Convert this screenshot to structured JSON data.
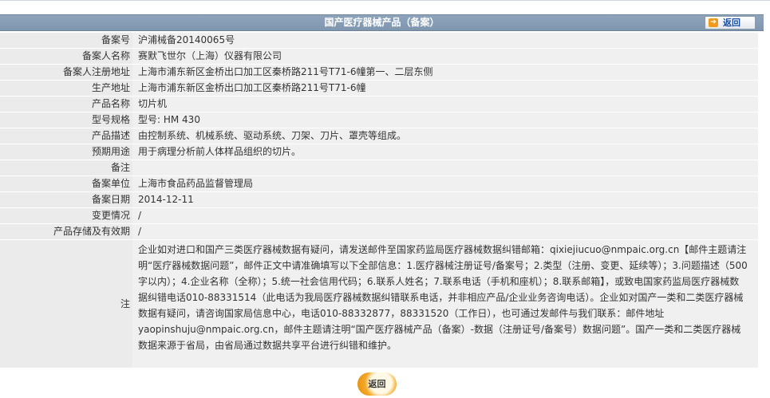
{
  "header": {
    "title": "国产医疗器械产品（备案）",
    "back_label": "返回",
    "back_icon": "arrow-right-icon"
  },
  "rows": [
    {
      "label": "备案号",
      "value": "沪浦械备20140065号"
    },
    {
      "label": "备案人名称",
      "value": "赛默飞世尔（上海）仪器有限公司"
    },
    {
      "label": "备案人注册地址",
      "value": "上海市浦东新区金桥出口加工区秦桥路211号T71-6幢第一、二层东侧"
    },
    {
      "label": "生产地址",
      "value": "上海市浦东新区金桥出口加工区秦桥路211号T71-6幢"
    },
    {
      "label": "产品名称",
      "value": "切片机"
    },
    {
      "label": "型号规格",
      "value": "型号: HM 430"
    },
    {
      "label": "产品描述",
      "value": "由控制系统、机械系统、驱动系统、刀架、刀片、罩壳等组成。"
    },
    {
      "label": "预期用途",
      "value": "用于病理分析前人体样品组织的切片。"
    },
    {
      "label": "备注",
      "value": ""
    },
    {
      "label": "备案单位",
      "value": "上海市食品药品监督管理局"
    },
    {
      "label": "备案日期",
      "value": "2014-12-11"
    },
    {
      "label": "变更情况",
      "value": "/"
    },
    {
      "label": "产品存储及有效期",
      "value": "/"
    }
  ],
  "note": {
    "label": "注",
    "text": "企业如对进口和国产三类医疗器械数据有疑问，请发送邮件至国家药监局医疗器械数据纠错邮箱：qixiejiucuo@nmpaic.org.cn【邮件主题请注明“医疗器械数据问题”，邮件正文中请准确填写以下全部信息：1.医疗器械注册证号/备案号；2.类型（注册、变更、延续等）；3.问题描述（500字以内）；4.企业名称（全称）；5.统一社会信用代码；6.联系人姓名；7.联系电话（手机和座机）；8.联系邮箱】，或致电国家药监局医疗器械数据纠错电话010-88331514（此电话为我局医疗器械数据纠错联系电话，并非相应产品/企业业务咨询电话）。企业如对国产一类和二类医疗器械数据有疑问，请咨询国家局信息中心，电话010-88332877，88331520（工作日），也可通过发邮件与我们联系：邮件地址yaopinshuju@nmpaic.org.cn，邮件主题请注明“国产医疗器械产品（备案）-数据（注册证号/备案号）数据问题”。国产一类和二类医疗器械数据来源于省局，由省局通过数据共享平台进行纠错和维护。"
  },
  "footer": {
    "back_label": "返回"
  }
}
